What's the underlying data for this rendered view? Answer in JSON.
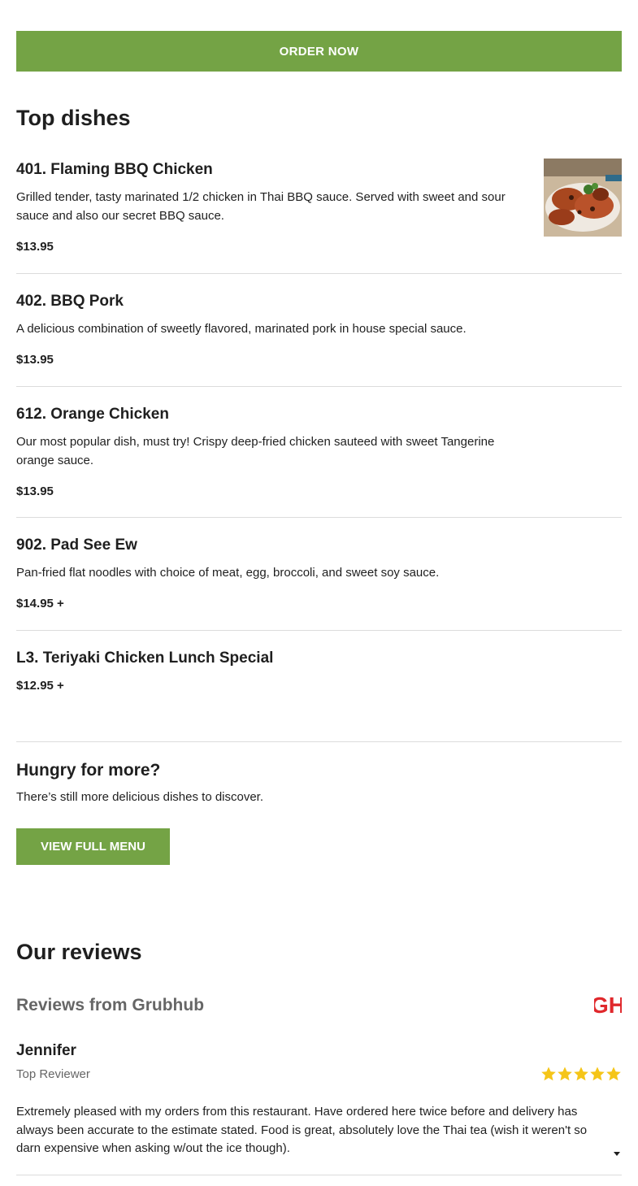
{
  "order_button": {
    "label": "ORDER NOW"
  },
  "top_dishes": {
    "title": "Top dishes",
    "dishes": [
      {
        "name": "401. Flaming BBQ Chicken",
        "description": "Grilled tender, tasty marinated 1/2 chicken in Thai BBQ sauce. Served with sweet and sour sauce and also our secret BBQ sauce.",
        "price": "$13.95",
        "has_image": true
      },
      {
        "name": "402. BBQ Pork",
        "description": "A delicious combination of sweetly flavored, marinated pork in house special sauce.",
        "price": "$13.95"
      },
      {
        "name": "612. Orange Chicken",
        "description": "Our most popular dish, must try! Crispy deep-fried chicken sauteed with sweet Tangerine orange sauce.",
        "price": "$13.95"
      },
      {
        "name": "902. Pad See Ew",
        "description": "Pan-fried flat noodles with choice of meat, egg, broccoli, and sweet soy sauce.",
        "price": "$14.95 +"
      },
      {
        "name": "L3. Teriyaki Chicken Lunch Special",
        "description": "",
        "price": "$12.95 +"
      }
    ]
  },
  "hungry": {
    "title": "Hungry for more?",
    "text": "There’s still more delicious dishes to discover.",
    "button_label": "VIEW FULL MENU"
  },
  "reviews": {
    "title": "Our reviews",
    "source_label": "Reviews from Grubhub",
    "logo_text": "GH",
    "items": [
      {
        "name": "Jennifer",
        "role": "Top Reviewer",
        "rating": 5,
        "text": "Extremely pleased with my orders from this restaurant. Have ordered here twice before and delivery has always been accurate to the estimate stated. Food is great, absolutely love the Thai tea (wish it weren't so darn expensive when asking w/out the ice though)."
      }
    ]
  },
  "colors": {
    "brand_green": "#74a345",
    "grubhub_red": "#e0282c",
    "star_gold": "#f5c518"
  },
  "icons": {
    "star": "star-icon",
    "expand": "chevron-down-icon",
    "logo": "grubhub-logo"
  }
}
